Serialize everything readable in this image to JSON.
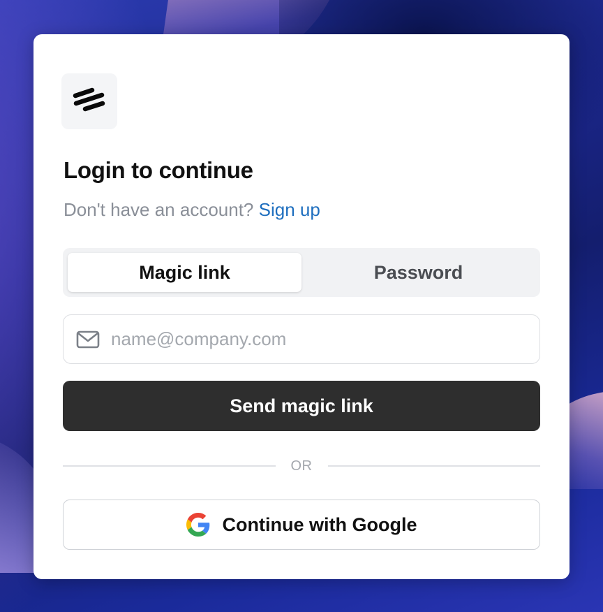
{
  "page": {
    "title": "Login to continue",
    "subtitle_text": "Don't have an account?",
    "signup_link": "Sign up"
  },
  "auth_tabs": [
    {
      "label": "Magic link",
      "active": true
    },
    {
      "label": "Password",
      "active": false
    }
  ],
  "email": {
    "placeholder": "name@company.com",
    "value": "",
    "icon": "mail-icon"
  },
  "buttons": {
    "send_magic_link": "Send magic link",
    "divider_text": "OR",
    "google": "Continue with Google"
  },
  "colors": {
    "link": "#1f6fbf",
    "primary_button": "#2e2e2e",
    "background": "#1d2a8c"
  },
  "icons": {
    "logo": "logo-icon",
    "google": "google-icon"
  }
}
